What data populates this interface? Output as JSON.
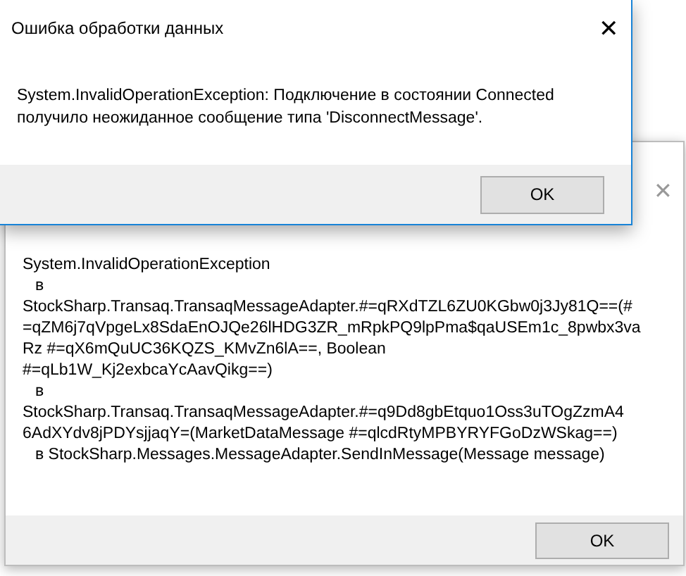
{
  "back_dialog": {
    "close_glyph": "✕",
    "lines": [
      {
        "kind": "text",
        "text": "System.InvalidOperationException"
      },
      {
        "kind": "indent",
        "text": "в"
      },
      {
        "kind": "text",
        "text": "StockSharp.Transaq.TransaqMessageAdapter.#=qRXdTZL6ZU0KGbw0j3Jy81Q==(#"
      },
      {
        "kind": "text",
        "text": "=qZM6j7qVpgeLx8SdaEnOJQe26lHDG3ZR_mRpkPQ9lpPma$qaUSEm1c_8pwbx3va"
      },
      {
        "kind": "text",
        "text": "Rz #=qX6mQuUC36KQZS_KMvZn6lA==, Boolean"
      },
      {
        "kind": "text",
        "text": "#=qLb1W_Kj2exbcaYcAavQikg==)"
      },
      {
        "kind": "indent",
        "text": "в"
      },
      {
        "kind": "text",
        "text": "StockSharp.Transaq.TransaqMessageAdapter.#=q9Dd8gbEtquo1Oss3uTOgZzmA4"
      },
      {
        "kind": "text",
        "text": "6AdXYdv8jPDYsjjaqY=(MarketDataMessage #=qlcdRtyMPBYRYFGoDzWSkag==)"
      },
      {
        "kind": "indent",
        "text": "в StockSharp.Messages.MessageAdapter.SendInMessage(Message message)"
      }
    ],
    "button": "OK"
  },
  "front_dialog": {
    "title": "Ошибка обработки данных",
    "message": "System.InvalidOperationException: Подключение в состоянии Connected получило неожиданное сообщение типа 'DisconnectMessage'.",
    "button": "OK"
  }
}
